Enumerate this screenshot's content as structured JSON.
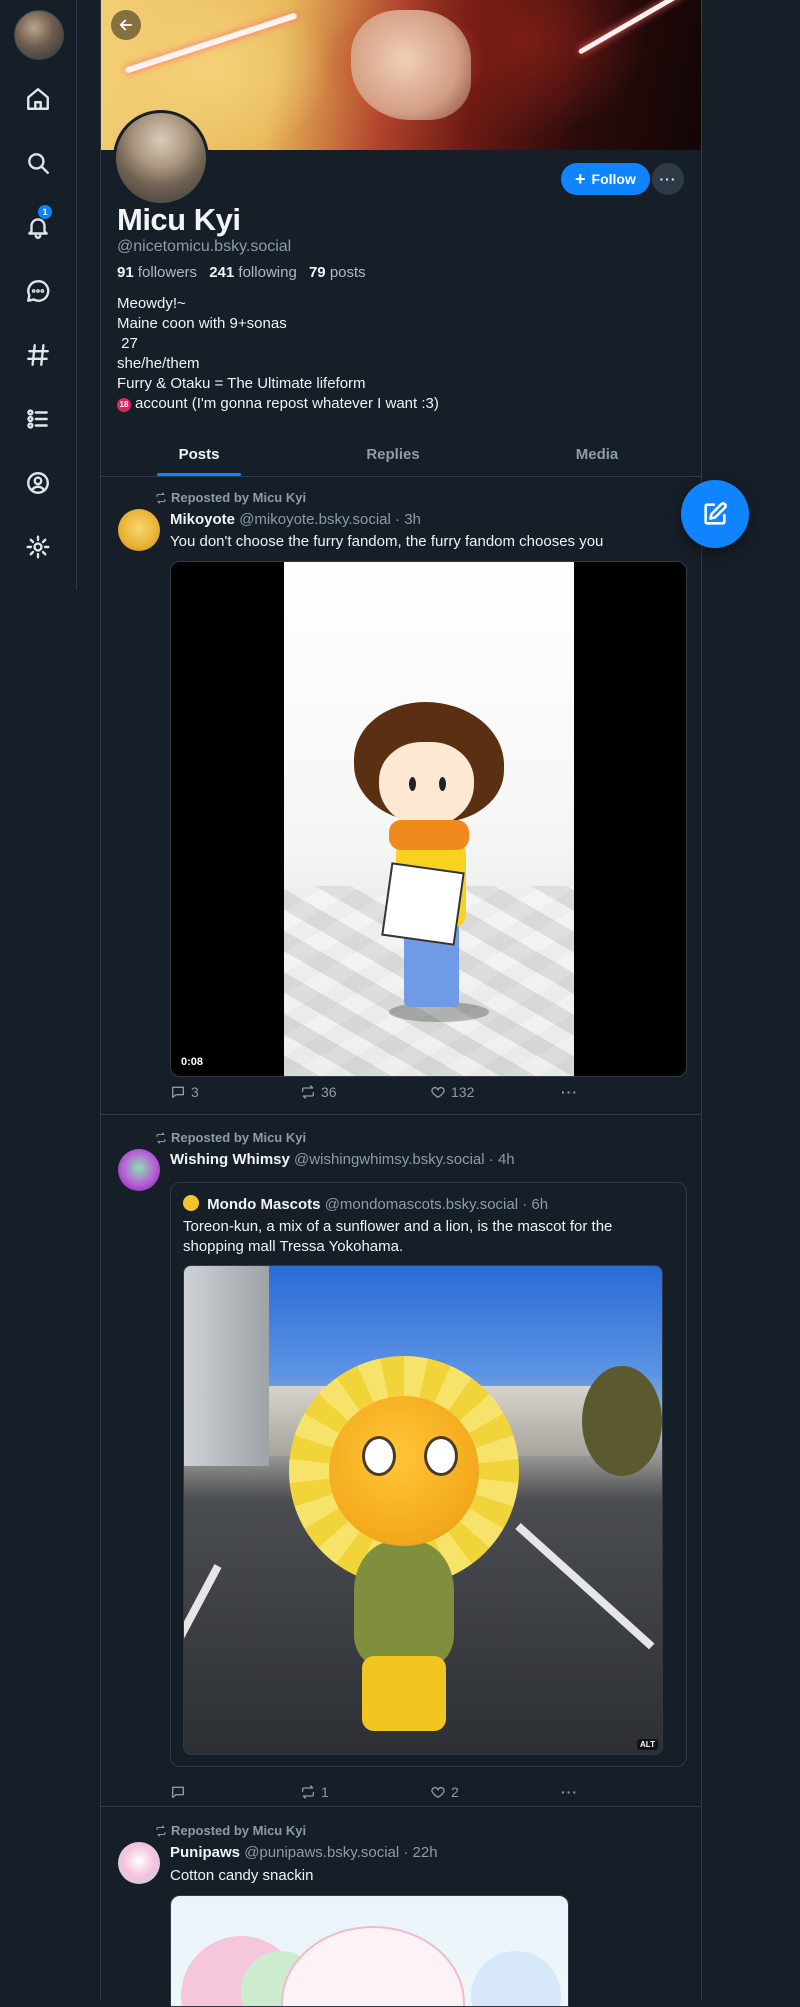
{
  "profile": {
    "display_name": "Micu Kyi",
    "handle": "@nicetomicu.bsky.social",
    "followers_count": "91",
    "followers_label": "followers",
    "following_count": "241",
    "following_label": "following",
    "posts_count": "79",
    "posts_label": "posts",
    "bio": {
      "line1": "Meowdy!~",
      "line2": "Maine coon with 9+sonas",
      "line3": " 27",
      "line4": "she/he/them",
      "line5": "Furry & Otaku = The Ultimate lifeform",
      "line6_badge": "18",
      "line6": "account (I'm gonna repost whatever I want :3)"
    },
    "follow_label": "Follow",
    "follow_icon": "+",
    "more_icon": "···"
  },
  "notifications": {
    "badge": "1"
  },
  "tabs": [
    {
      "label": "Posts"
    },
    {
      "label": "Replies"
    },
    {
      "label": "Media"
    }
  ],
  "feed": [
    {
      "reposted_by": "Reposted by Micu Kyi",
      "author": "Mikoyote",
      "handle": "@mikoyote.bsky.social",
      "time": "· 3h",
      "text": "You don't choose the furry fandom, the furry fandom chooses you",
      "video_time": "0:08",
      "replies": "3",
      "reposts": "36",
      "likes": "132",
      "more": "···"
    },
    {
      "reposted_by": "Reposted by Micu Kyi",
      "author": "Wishing Whimsy",
      "handle": "@wishingwhimsy.bsky.social",
      "time": "· 4h",
      "quote": {
        "author": "Mondo Mascots",
        "handle": "@mondomascots.bsky.social",
        "time": "· 6h",
        "text": "Toreon-kun, a mix of a sunflower and a lion, is the mascot for the shopping mall Tressa Yokohama.",
        "alt_badge": "ALT"
      },
      "replies": "",
      "reposts": "1",
      "likes": "2",
      "more": "···"
    },
    {
      "reposted_by": "Reposted by Micu Kyi",
      "author": "Punipaws",
      "handle": "@punipaws.bsky.social",
      "time": "· 22h",
      "text": "Cotton candy snackin"
    }
  ],
  "colors": {
    "background": "#161e27",
    "accent": "#1083fe",
    "muted_text": "#8d9baa",
    "border": "#2e3a47"
  }
}
